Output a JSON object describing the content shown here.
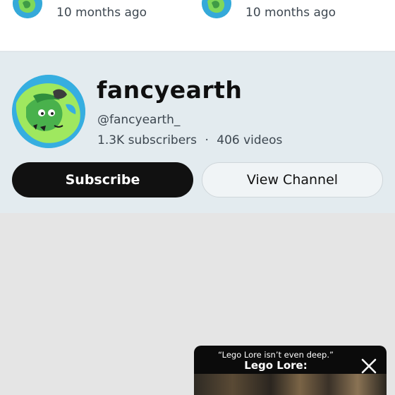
{
  "recent_items": [
    {
      "age": "10 months ago"
    },
    {
      "age": "10 months ago"
    }
  ],
  "channel": {
    "name": "fancyearth",
    "handle": "@fancyearth_",
    "subscribers": "1.3K subscribers",
    "separator": "·",
    "videos": "406 videos",
    "avatar_icon": "earth-avatar"
  },
  "actions": {
    "subscribe_label": "Subscribe",
    "view_channel_label": "View Channel"
  },
  "mini_player": {
    "quote": "“Lego Lore isn’t even deep.”",
    "title": "Lego Lore:",
    "close_icon": "close-icon"
  },
  "colors": {
    "card_background": "#e3ebef",
    "subscribe_background": "#111111",
    "page_background": "#e5e5e5"
  }
}
